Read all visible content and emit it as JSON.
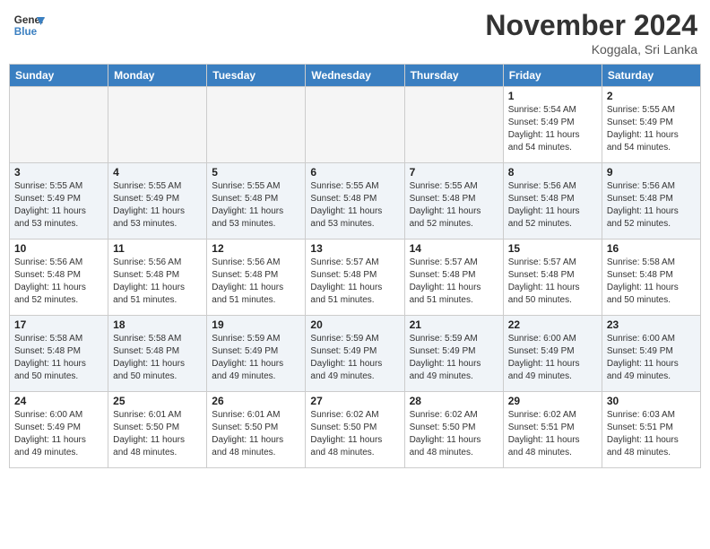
{
  "header": {
    "logo_general": "General",
    "logo_blue": "Blue",
    "month_title": "November 2024",
    "location": "Koggala, Sri Lanka"
  },
  "columns": [
    "Sunday",
    "Monday",
    "Tuesday",
    "Wednesday",
    "Thursday",
    "Friday",
    "Saturday"
  ],
  "weeks": [
    {
      "days": [
        {
          "num": "",
          "info": ""
        },
        {
          "num": "",
          "info": ""
        },
        {
          "num": "",
          "info": ""
        },
        {
          "num": "",
          "info": ""
        },
        {
          "num": "",
          "info": ""
        },
        {
          "num": "1",
          "info": "Sunrise: 5:54 AM\nSunset: 5:49 PM\nDaylight: 11 hours\nand 54 minutes."
        },
        {
          "num": "2",
          "info": "Sunrise: 5:55 AM\nSunset: 5:49 PM\nDaylight: 11 hours\nand 54 minutes."
        }
      ]
    },
    {
      "days": [
        {
          "num": "3",
          "info": "Sunrise: 5:55 AM\nSunset: 5:49 PM\nDaylight: 11 hours\nand 53 minutes."
        },
        {
          "num": "4",
          "info": "Sunrise: 5:55 AM\nSunset: 5:49 PM\nDaylight: 11 hours\nand 53 minutes."
        },
        {
          "num": "5",
          "info": "Sunrise: 5:55 AM\nSunset: 5:48 PM\nDaylight: 11 hours\nand 53 minutes."
        },
        {
          "num": "6",
          "info": "Sunrise: 5:55 AM\nSunset: 5:48 PM\nDaylight: 11 hours\nand 53 minutes."
        },
        {
          "num": "7",
          "info": "Sunrise: 5:55 AM\nSunset: 5:48 PM\nDaylight: 11 hours\nand 52 minutes."
        },
        {
          "num": "8",
          "info": "Sunrise: 5:56 AM\nSunset: 5:48 PM\nDaylight: 11 hours\nand 52 minutes."
        },
        {
          "num": "9",
          "info": "Sunrise: 5:56 AM\nSunset: 5:48 PM\nDaylight: 11 hours\nand 52 minutes."
        }
      ]
    },
    {
      "days": [
        {
          "num": "10",
          "info": "Sunrise: 5:56 AM\nSunset: 5:48 PM\nDaylight: 11 hours\nand 52 minutes."
        },
        {
          "num": "11",
          "info": "Sunrise: 5:56 AM\nSunset: 5:48 PM\nDaylight: 11 hours\nand 51 minutes."
        },
        {
          "num": "12",
          "info": "Sunrise: 5:56 AM\nSunset: 5:48 PM\nDaylight: 11 hours\nand 51 minutes."
        },
        {
          "num": "13",
          "info": "Sunrise: 5:57 AM\nSunset: 5:48 PM\nDaylight: 11 hours\nand 51 minutes."
        },
        {
          "num": "14",
          "info": "Sunrise: 5:57 AM\nSunset: 5:48 PM\nDaylight: 11 hours\nand 51 minutes."
        },
        {
          "num": "15",
          "info": "Sunrise: 5:57 AM\nSunset: 5:48 PM\nDaylight: 11 hours\nand 50 minutes."
        },
        {
          "num": "16",
          "info": "Sunrise: 5:58 AM\nSunset: 5:48 PM\nDaylight: 11 hours\nand 50 minutes."
        }
      ]
    },
    {
      "days": [
        {
          "num": "17",
          "info": "Sunrise: 5:58 AM\nSunset: 5:48 PM\nDaylight: 11 hours\nand 50 minutes."
        },
        {
          "num": "18",
          "info": "Sunrise: 5:58 AM\nSunset: 5:48 PM\nDaylight: 11 hours\nand 50 minutes."
        },
        {
          "num": "19",
          "info": "Sunrise: 5:59 AM\nSunset: 5:49 PM\nDaylight: 11 hours\nand 49 minutes."
        },
        {
          "num": "20",
          "info": "Sunrise: 5:59 AM\nSunset: 5:49 PM\nDaylight: 11 hours\nand 49 minutes."
        },
        {
          "num": "21",
          "info": "Sunrise: 5:59 AM\nSunset: 5:49 PM\nDaylight: 11 hours\nand 49 minutes."
        },
        {
          "num": "22",
          "info": "Sunrise: 6:00 AM\nSunset: 5:49 PM\nDaylight: 11 hours\nand 49 minutes."
        },
        {
          "num": "23",
          "info": "Sunrise: 6:00 AM\nSunset: 5:49 PM\nDaylight: 11 hours\nand 49 minutes."
        }
      ]
    },
    {
      "days": [
        {
          "num": "24",
          "info": "Sunrise: 6:00 AM\nSunset: 5:49 PM\nDaylight: 11 hours\nand 49 minutes."
        },
        {
          "num": "25",
          "info": "Sunrise: 6:01 AM\nSunset: 5:50 PM\nDaylight: 11 hours\nand 48 minutes."
        },
        {
          "num": "26",
          "info": "Sunrise: 6:01 AM\nSunset: 5:50 PM\nDaylight: 11 hours\nand 48 minutes."
        },
        {
          "num": "27",
          "info": "Sunrise: 6:02 AM\nSunset: 5:50 PM\nDaylight: 11 hours\nand 48 minutes."
        },
        {
          "num": "28",
          "info": "Sunrise: 6:02 AM\nSunset: 5:50 PM\nDaylight: 11 hours\nand 48 minutes."
        },
        {
          "num": "29",
          "info": "Sunrise: 6:02 AM\nSunset: 5:51 PM\nDaylight: 11 hours\nand 48 minutes."
        },
        {
          "num": "30",
          "info": "Sunrise: 6:03 AM\nSunset: 5:51 PM\nDaylight: 11 hours\nand 48 minutes."
        }
      ]
    }
  ]
}
